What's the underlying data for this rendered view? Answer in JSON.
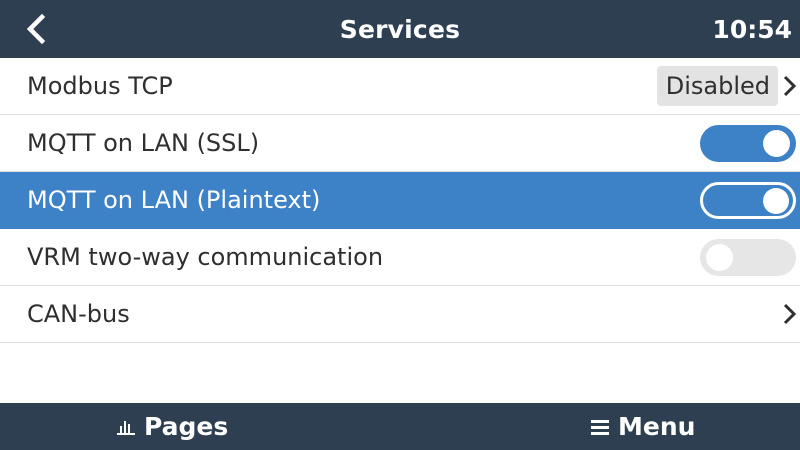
{
  "header": {
    "title": "Services",
    "time": "10:54",
    "back_icon": "chevron-left-icon"
  },
  "rows": [
    {
      "label": "Modbus TCP",
      "value": "Disabled",
      "control": "value-with-chevron"
    },
    {
      "label": "MQTT on LAN (SSL)",
      "control": "toggle",
      "state": "on"
    },
    {
      "label": "MQTT on LAN (Plaintext)",
      "control": "toggle",
      "state": "on",
      "selected": true
    },
    {
      "label": "VRM two-way communication",
      "control": "toggle",
      "state": "off"
    },
    {
      "label": "CAN-bus",
      "control": "chevron"
    }
  ],
  "footer": {
    "pages_label": "Pages",
    "pages_icon": "bar-chart-icon",
    "menu_label": "Menu",
    "menu_icon": "hamburger-menu-icon"
  },
  "colors": {
    "header_bg": "#2f3f52",
    "accent": "#3d81c6",
    "toggle_off": "#e6e6e6",
    "value_box_bg": "#e3e3e3",
    "divider": "#dde1e5"
  }
}
